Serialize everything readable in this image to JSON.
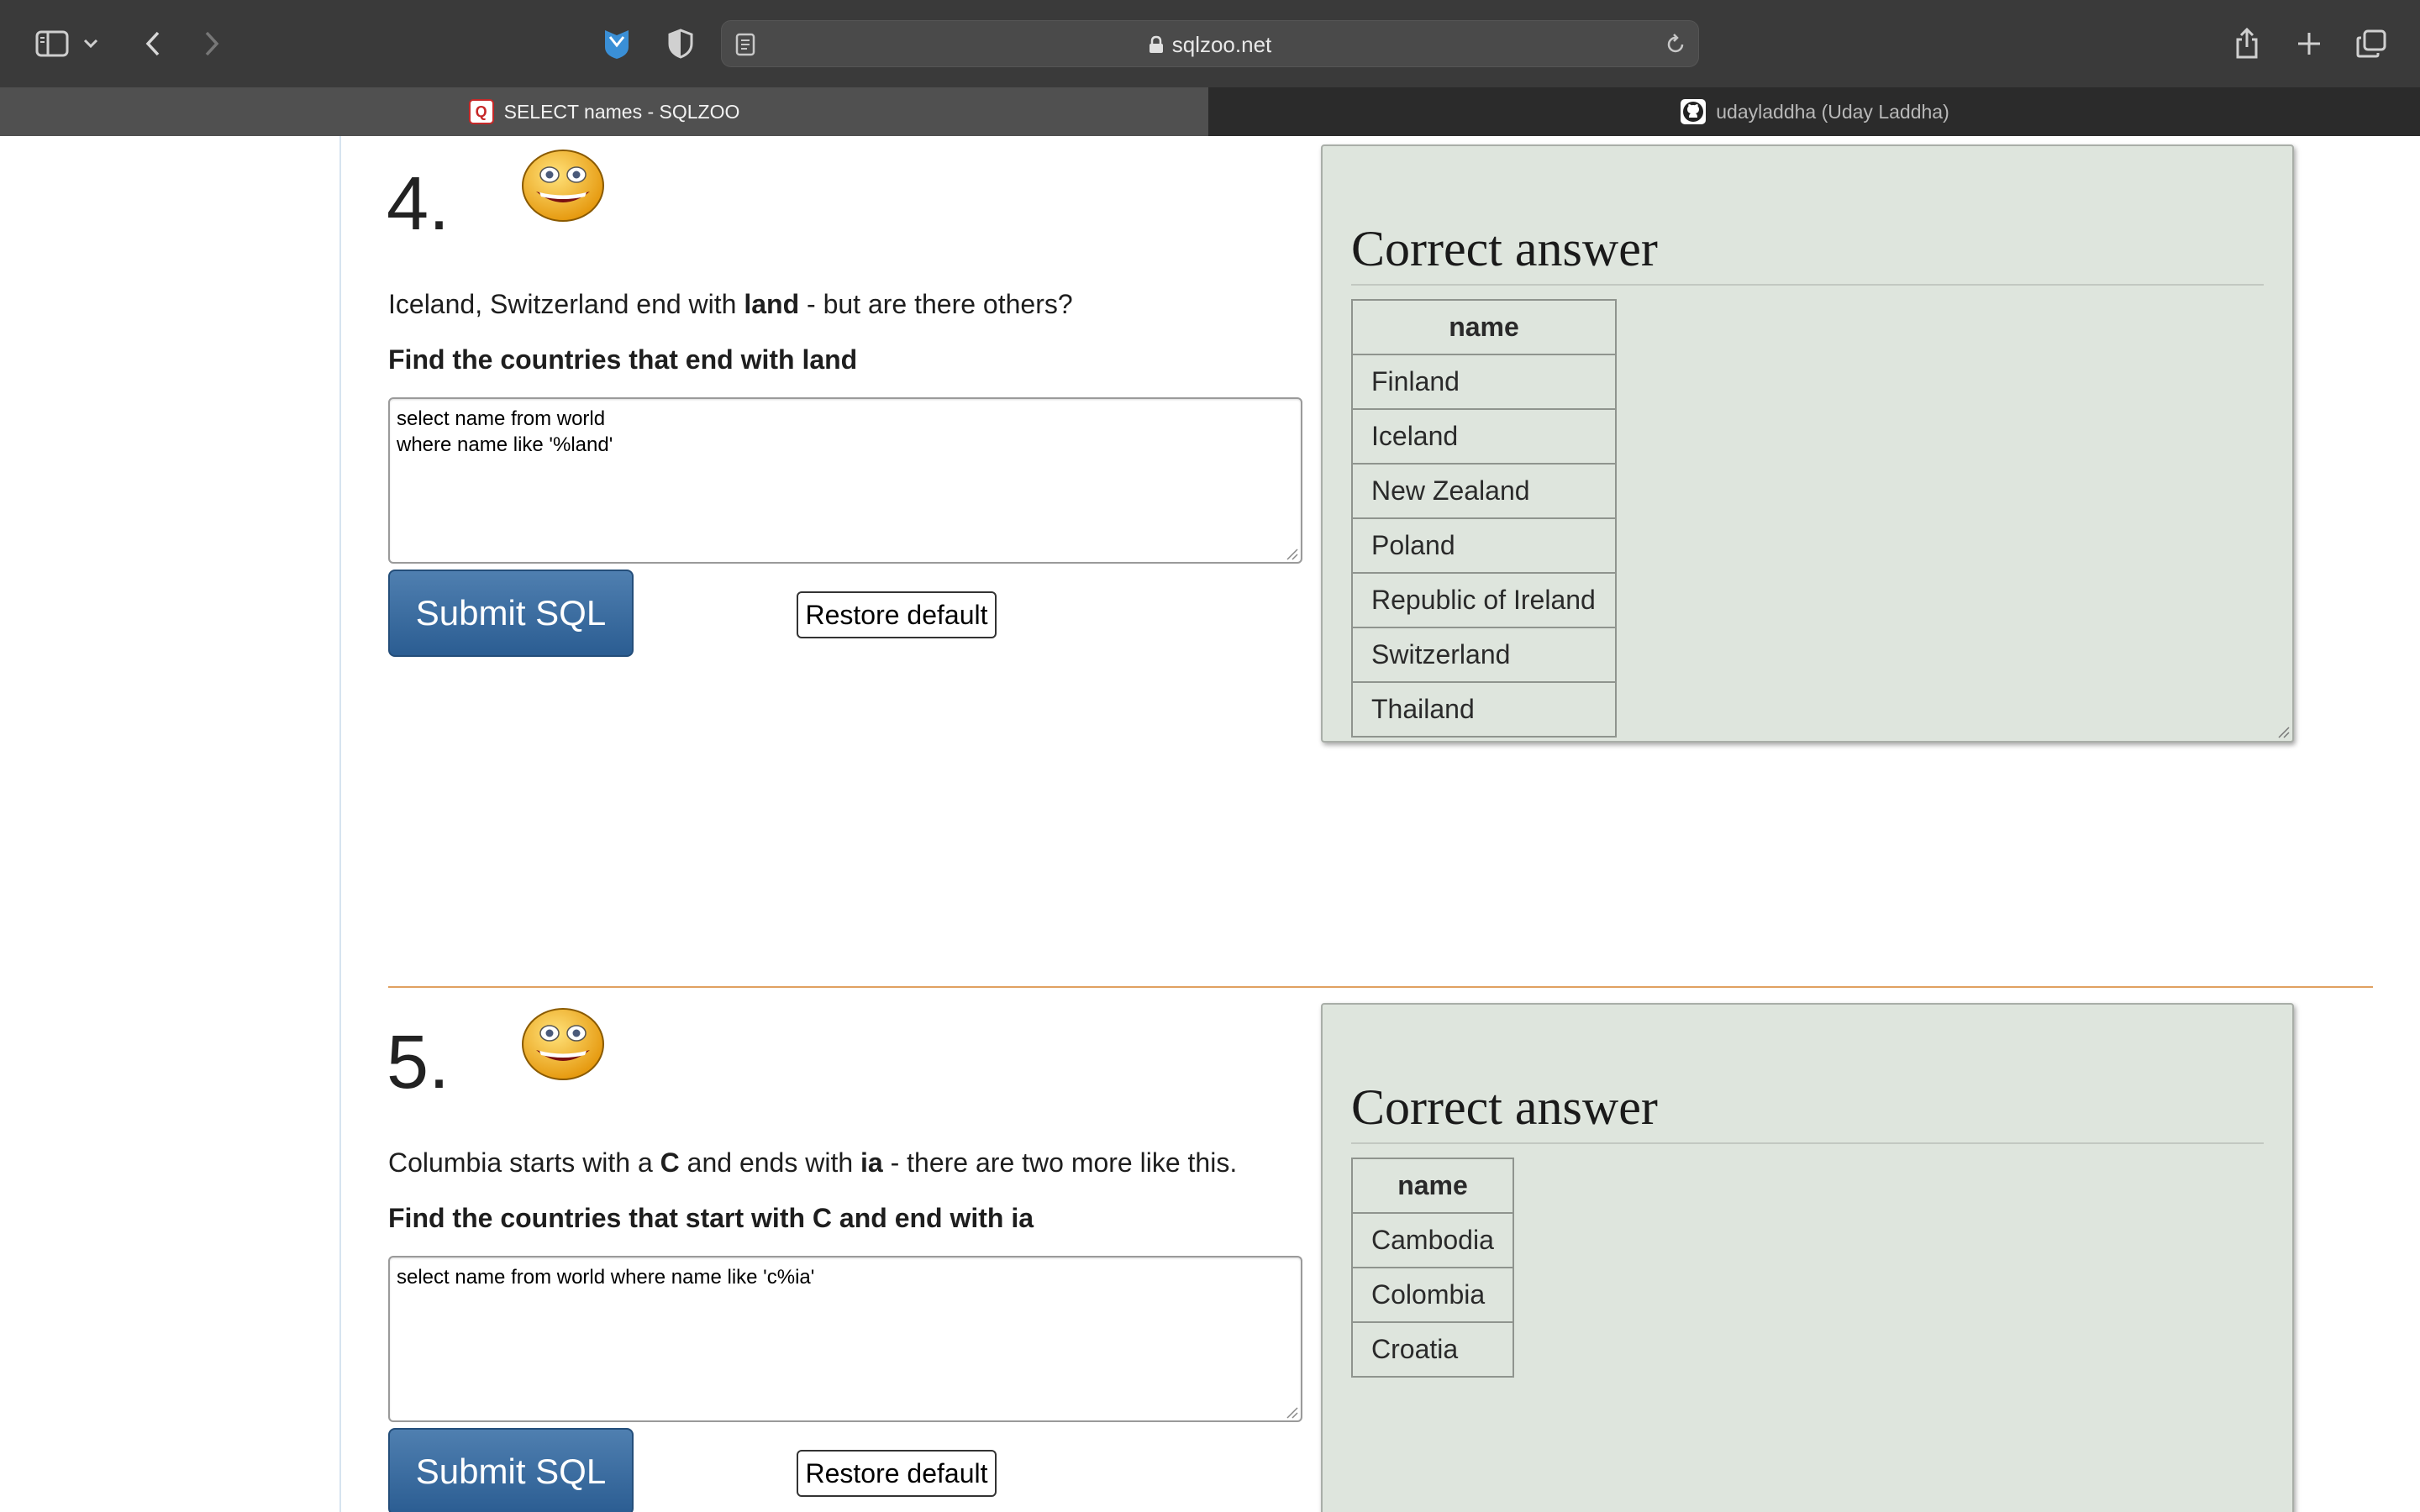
{
  "browser": {
    "url": "sqlzoo.net",
    "tabs": [
      {
        "title": "SELECT names - SQLZOO",
        "active": true
      },
      {
        "title": "udayladdha (Uday Laddha)",
        "active": false
      }
    ],
    "icons": {
      "sidebar": "sidebar-icon",
      "back": "chevron-left-icon",
      "forward": "chevron-right-icon",
      "share": "share-icon",
      "new_tab": "plus-icon",
      "tab_overview": "tabs-icon"
    }
  },
  "sections": [
    {
      "number": "4.",
      "question": {
        "pre": "Iceland, Switzerland end with ",
        "bold": "land",
        "post": " - but are there others?"
      },
      "task": "Find the countries that end with land",
      "sql": "select name from world\nwhere name like '%land'",
      "submit_label": "Submit SQL",
      "restore_label": "Restore default",
      "answer": {
        "title": "Correct answer",
        "header": "name",
        "rows": [
          "Finland",
          "Iceland",
          "New Zealand",
          "Poland",
          "Republic of Ireland",
          "Switzerland",
          "Thailand"
        ]
      }
    },
    {
      "number": "5.",
      "question": {
        "pre": "Columbia starts with a ",
        "bold": "C",
        "mid": " and ends with ",
        "bold2": "ia",
        "post": " - there are two more like this."
      },
      "task": "Find the countries that start with C and end with ia",
      "sql": "select name from world where name like 'c%ia'",
      "submit_label": "Submit SQL",
      "restore_label": "Restore default",
      "answer": {
        "title": "Correct answer",
        "header": "name",
        "rows": [
          "Cambodia",
          "Colombia",
          "Croatia"
        ]
      }
    }
  ],
  "colors": {
    "answer_panel": "#dee5dd",
    "submit_button": "#2b5d92",
    "divider": "#e0a060"
  }
}
